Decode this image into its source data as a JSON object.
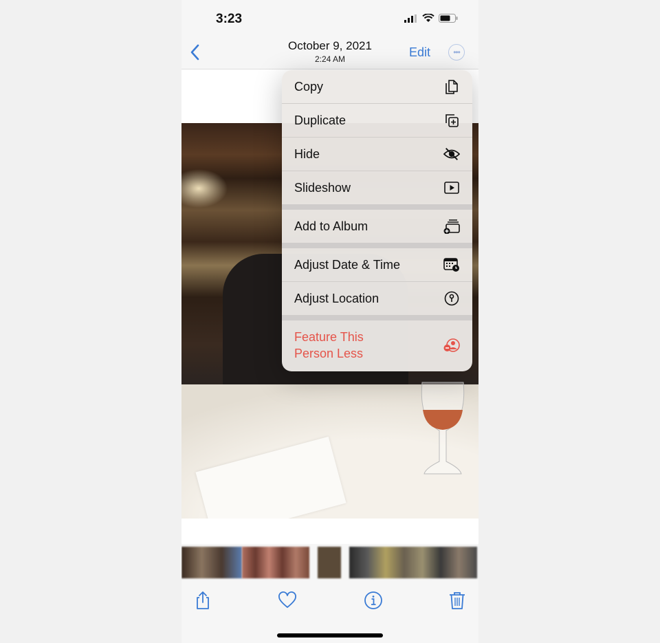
{
  "status_bar": {
    "time": "3:23",
    "icons": [
      "cellular-signal-icon",
      "wifi-icon",
      "battery-icon"
    ]
  },
  "nav": {
    "back_icon": "chevron-left-icon",
    "title": "October 9, 2021",
    "subtitle": "2:24 AM",
    "edit_label": "Edit",
    "more_icon": "ellipsis-circle-icon",
    "accent_color": "#3a7bd5"
  },
  "menu": {
    "groups": [
      [
        {
          "label": "Copy",
          "icon": "copy-icon"
        },
        {
          "label": "Duplicate",
          "icon": "duplicate-icon"
        },
        {
          "label": "Hide",
          "icon": "eye-slash-icon"
        },
        {
          "label": "Slideshow",
          "icon": "play-rectangle-icon"
        }
      ],
      [
        {
          "label": "Add to Album",
          "icon": "add-to-album-icon"
        }
      ],
      [
        {
          "label": "Adjust Date & Time",
          "icon": "calendar-clock-icon"
        },
        {
          "label": "Adjust Location",
          "icon": "location-pin-icon"
        }
      ],
      [
        {
          "label": "Feature This Person Less",
          "line1": "Feature This",
          "line2": "Person Less",
          "icon": "person-minus-icon",
          "destructive": true
        }
      ]
    ],
    "destructive_color": "#e5544a"
  },
  "toolbar": {
    "items": [
      {
        "name": "share",
        "icon": "share-icon"
      },
      {
        "name": "favorite",
        "icon": "heart-icon"
      },
      {
        "name": "info",
        "icon": "info-circle-icon"
      },
      {
        "name": "delete",
        "icon": "trash-icon"
      }
    ]
  }
}
